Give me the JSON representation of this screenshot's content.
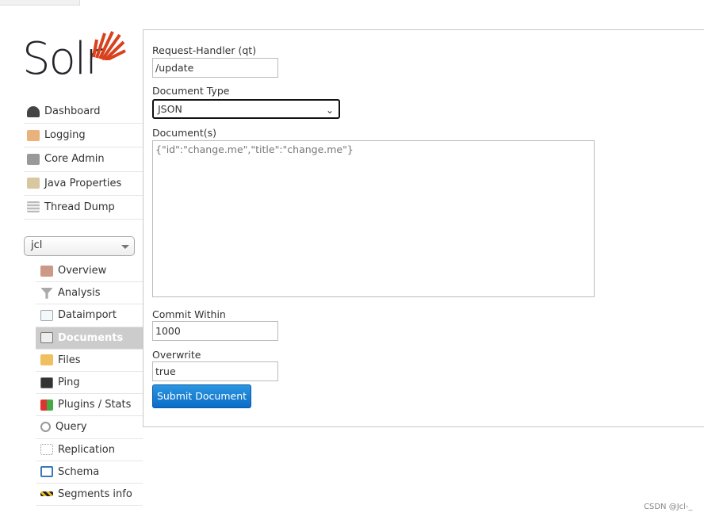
{
  "logo": {
    "text": "Solr",
    "accent": "#d9411e"
  },
  "nav": [
    {
      "label": "Dashboard",
      "icon": "dashboard-icon"
    },
    {
      "label": "Logging",
      "icon": "logging-icon"
    },
    {
      "label": "Core Admin",
      "icon": "core-admin-icon"
    },
    {
      "label": "Java Properties",
      "icon": "java-properties-icon"
    },
    {
      "label": "Thread Dump",
      "icon": "thread-dump-icon"
    }
  ],
  "core_selector": {
    "value": "jcl"
  },
  "core_nav": [
    {
      "label": "Overview",
      "icon": "home-icon"
    },
    {
      "label": "Analysis",
      "icon": "funnel-icon"
    },
    {
      "label": "Dataimport",
      "icon": "dataimport-icon"
    },
    {
      "label": "Documents",
      "icon": "documents-icon",
      "active": true
    },
    {
      "label": "Files",
      "icon": "folder-icon"
    },
    {
      "label": "Ping",
      "icon": "monitor-icon"
    },
    {
      "label": "Plugins / Stats",
      "icon": "blocks-icon"
    },
    {
      "label": "Query",
      "icon": "magnifier-icon"
    },
    {
      "label": "Replication",
      "icon": "replication-icon"
    },
    {
      "label": "Schema",
      "icon": "book-icon"
    },
    {
      "label": "Segments info",
      "icon": "barrier-icon"
    }
  ],
  "form": {
    "handler_label": "Request-Handler (qt)",
    "handler_value": "/update",
    "doctype_label": "Document Type",
    "doctype_value": "JSON",
    "docs_label": "Document(s)",
    "docs_value": "{\"id\":\"change.me\",\"title\":\"change.me\"}",
    "commit_label": "Commit Within",
    "commit_value": "1000",
    "overwrite_label": "Overwrite",
    "overwrite_value": "true",
    "submit_label": "Submit Document"
  },
  "watermark": "CSDN @Jcl-_"
}
